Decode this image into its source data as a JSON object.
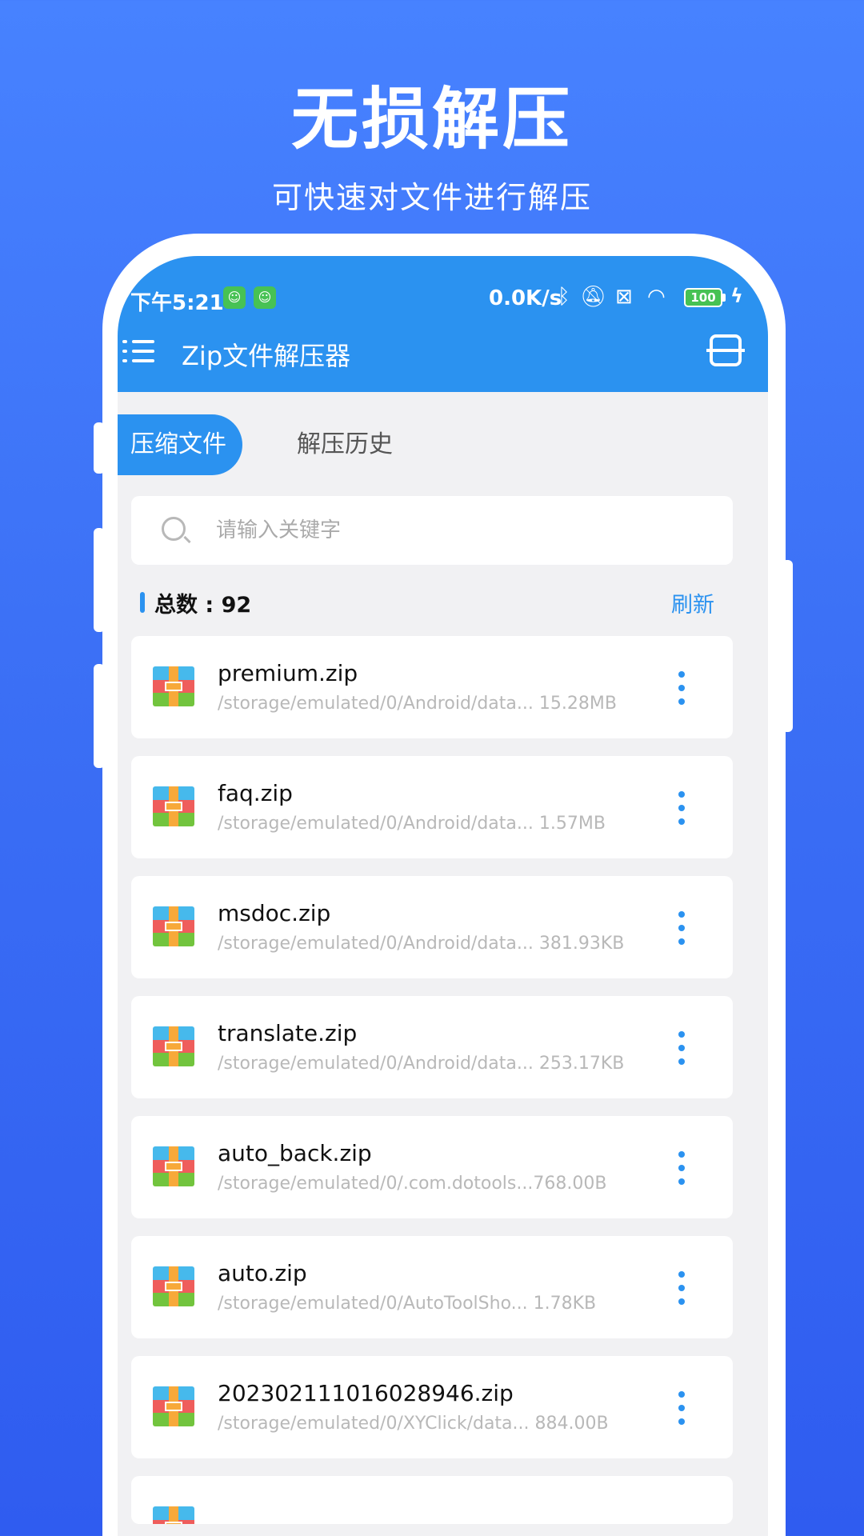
{
  "promo": {
    "title": "无损解压",
    "subtitle": "可快速对文件进行解压"
  },
  "status_bar": {
    "time": "下午5:21",
    "speed": "0.0K/s",
    "battery": "100"
  },
  "app": {
    "title": "Zip文件解压器"
  },
  "tabs": [
    {
      "label": "压缩文件",
      "active": true
    },
    {
      "label": "解压历史",
      "active": false
    }
  ],
  "search": {
    "placeholder": "请输入关键字",
    "value": ""
  },
  "summary": {
    "count_label": "总数 : 92",
    "refresh_label": "刷新"
  },
  "files": [
    {
      "name": "premium.zip",
      "path": "/storage/emulated/0/Android/data...",
      "size": "15.28MB"
    },
    {
      "name": "faq.zip",
      "path": "/storage/emulated/0/Android/data...",
      "size": "1.57MB"
    },
    {
      "name": "msdoc.zip",
      "path": "/storage/emulated/0/Android/data...",
      "size": "381.93KB"
    },
    {
      "name": "translate.zip",
      "path": "/storage/emulated/0/Android/data...",
      "size": "253.17KB"
    },
    {
      "name": "auto_back.zip",
      "path": "/storage/emulated/0/.com.dotools...",
      "size": "768.00B"
    },
    {
      "name": "auto.zip",
      "path": "/storage/emulated/0/AutoToolSho...",
      "size": "1.78KB"
    },
    {
      "name": "20230211101602894​6.zip",
      "path": "/storage/emulated/0/XYClick/data...",
      "size": "884.00B"
    }
  ],
  "icons": {
    "menu": "menu-icon",
    "scan": "scan-icon",
    "search": "search-icon",
    "more": "more-vertical-icon",
    "file": "zip-archive-icon"
  },
  "colors": {
    "accent": "#2b92f0",
    "background_top": "#4782ff",
    "background_bottom": "#2f5cf0"
  }
}
